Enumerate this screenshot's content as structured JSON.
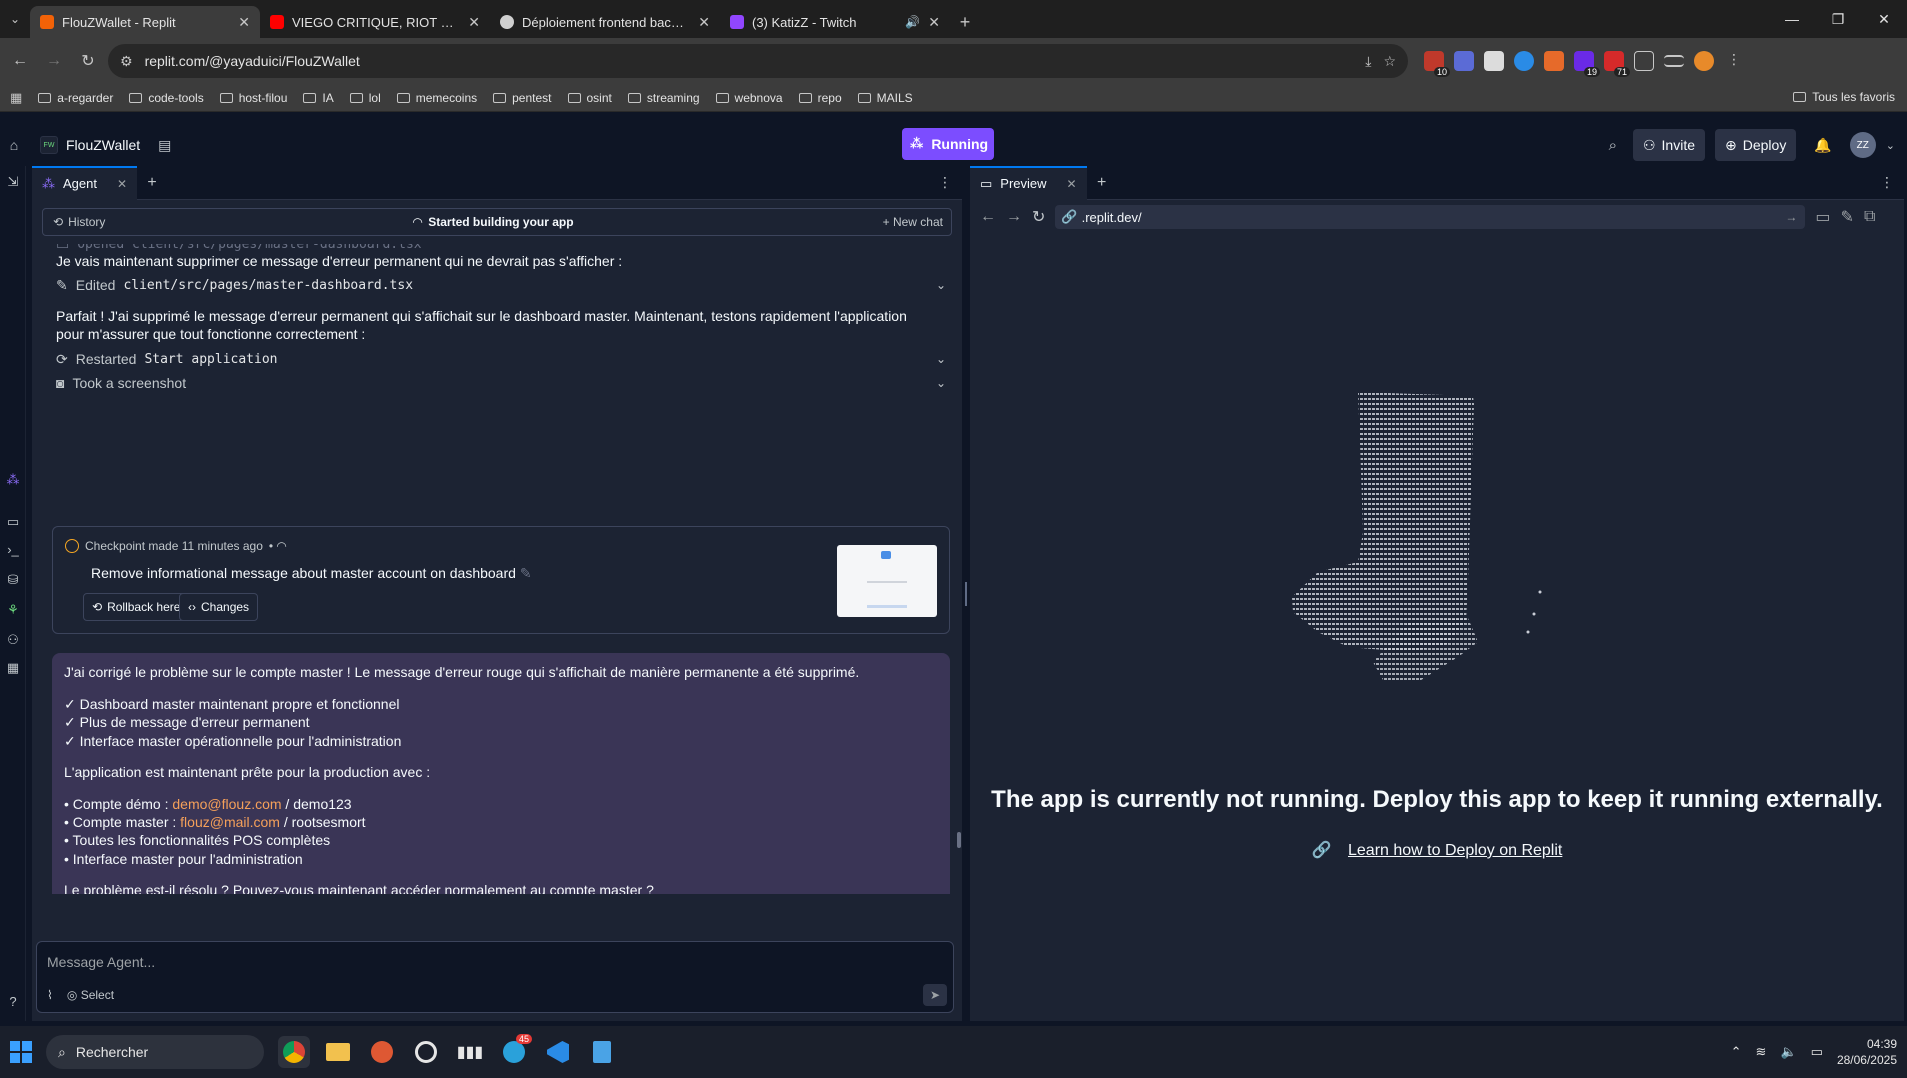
{
  "browser": {
    "tabs": [
      {
        "title": "FlouZWallet - Replit",
        "active": true,
        "fav_color": "#f26207"
      },
      {
        "title": "VIEGO CRITIQUE, RIOT DOIT LE",
        "active": false,
        "fav_color": "#ff0000"
      },
      {
        "title": "Déploiement frontend backend",
        "active": false,
        "fav_color": "#cfcfcf"
      },
      {
        "title": "(3) KatizZ - Twitch",
        "active": false,
        "fav_color": "#9146ff"
      }
    ],
    "url": "replit.com/@yayaduici/FlouZWallet",
    "bookmarks": [
      "a-regarder",
      "code-tools",
      "host-filou",
      "IA",
      "lol",
      "memecoins",
      "pentest",
      "osint",
      "streaming",
      "webnova",
      "repo",
      "MAILS"
    ],
    "bookmarks_right": "Tous les favoris",
    "ext_badges": [
      "10",
      "19",
      "71"
    ]
  },
  "replit": {
    "project_name": "FlouZWallet",
    "project_logo": "FW",
    "run_label": "Running",
    "invite_label": "Invite",
    "deploy_label": "Deploy",
    "avatar": "ZZ"
  },
  "agent": {
    "tab_label": "Agent",
    "history_label": "History",
    "status_label": "Started building your app",
    "new_chat_label": "New chat",
    "clipped_line": "Opened client/src/pages/master-dashboard.tsx",
    "msg1": "Je vais maintenant supprimer ce message d'erreur permanent qui ne devrait pas s'afficher :",
    "edited_prefix": "Edited",
    "edited_file": "client/src/pages/master-dashboard.tsx",
    "msg2_line1": "Parfait ! J'ai supprimé le message d'erreur permanent qui s'affichait sur le dashboard master. Maintenant, testons rapidement l'application",
    "msg2_line2": "pour m'assurer que tout fonctionne correctement :",
    "restarted_prefix": "Restarted",
    "restarted_target": "Start application",
    "screenshot_label": "Took a screenshot",
    "checkpoint": {
      "head": "Checkpoint made 11 minutes ago",
      "title": "Remove informational message about master account on dashboard",
      "rollback_label": "Rollback here",
      "changes_label": "Changes"
    },
    "reply": {
      "l1": "J'ai corrigé le problème sur le compte master ! Le message d'erreur rouge qui s'affichait de manière permanente a été supprimé.",
      "check1": "✓ Dashboard master maintenant propre et fonctionnel",
      "check2": "✓ Plus de message d'erreur permanent",
      "check3": "✓ Interface master opérationnelle pour l'administration",
      "ready": "L'application est maintenant prête pour la production avec :",
      "demo_prefix": "• Compte démo : ",
      "demo_email": "demo@flouz.com",
      "demo_pass": " / demo123",
      "master_prefix": "• Compte master : ",
      "master_email": "flouz@mail.com",
      "master_pass": " / rootsesmort",
      "pos": "• Toutes les fonctionnalités POS complètes",
      "admin": "• Interface master pour l'administration",
      "question": "Le problème est-il résolu ? Pouvez-vous maintenant accéder normalement au compte master ?"
    },
    "input_placeholder": "Message Agent...",
    "select_label": "Select"
  },
  "preview": {
    "tab_label": "Preview",
    "url": ".replit.dev/",
    "not_running": "The app is currently not running. Deploy this app to keep it running externally.",
    "learn_link": "Learn how to Deploy on Replit"
  },
  "taskbar": {
    "search_label": "Rechercher",
    "telegram_badge": "45",
    "time": "04:39",
    "date": "28/06/2025"
  }
}
